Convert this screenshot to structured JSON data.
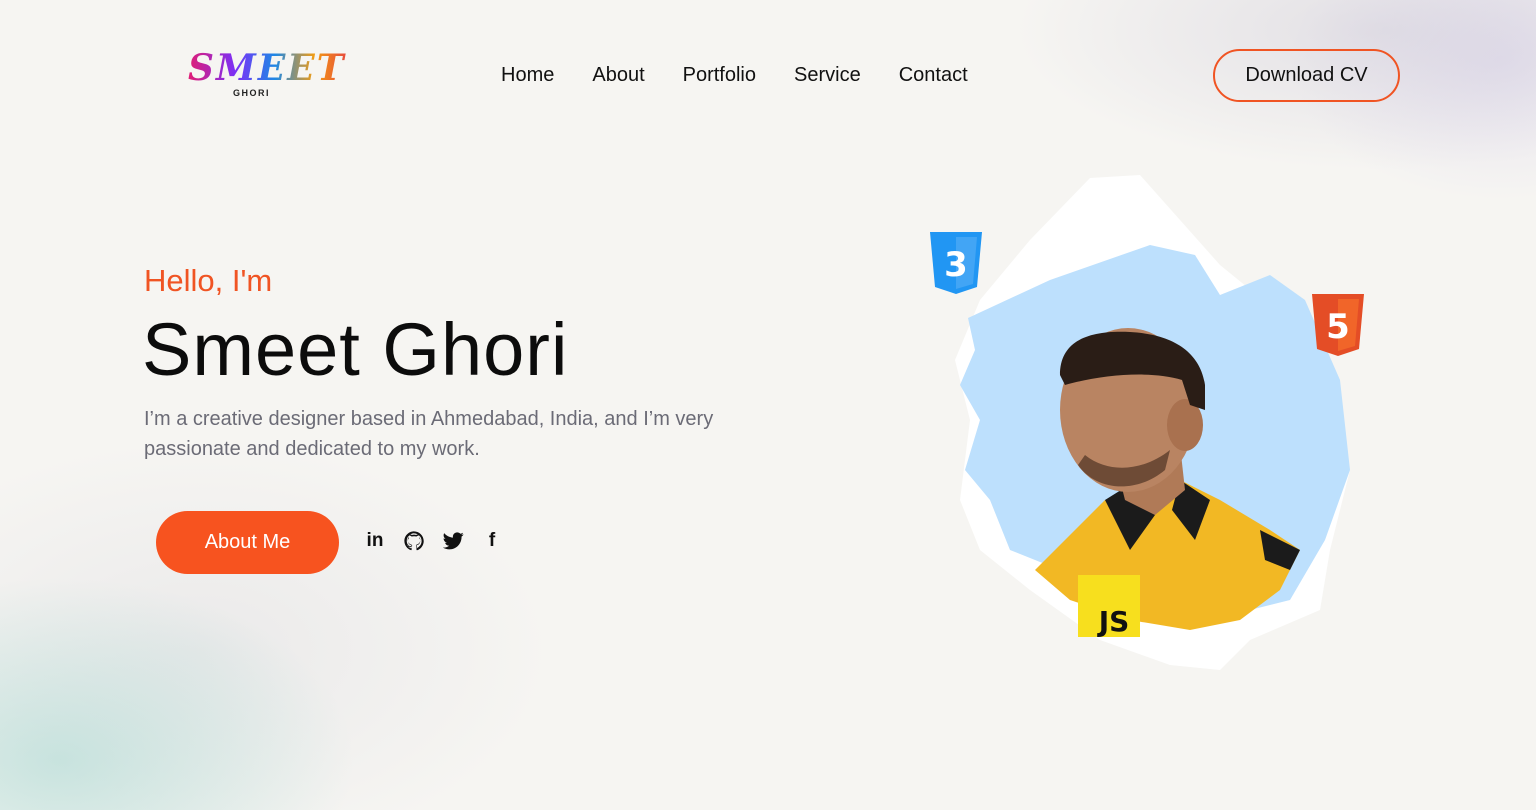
{
  "header": {
    "logo_main": "SMEET",
    "logo_sub": "GHORI",
    "nav": [
      "Home",
      "About",
      "Portfolio",
      "Service",
      "Contact"
    ],
    "cta_label": "Download CV"
  },
  "hero": {
    "greeting": "Hello, I'm",
    "name": "Smeet Ghori",
    "description": "I’m a creative designer based in Ahmedabad, India, and I’m very passionate and dedicated to my work.",
    "about_label": "About Me",
    "socials": [
      "linkedin-icon",
      "github-icon",
      "twitter-icon",
      "facebook-icon"
    ],
    "social_glyphs": {
      "linkedin": "in",
      "facebook": "f"
    }
  },
  "badges": {
    "css": {
      "label": "3",
      "color": "#2196f3"
    },
    "html": {
      "label": "5",
      "color": "#f1652a"
    },
    "js": {
      "label": "JS",
      "color": "#f7df1e"
    }
  },
  "colors": {
    "accent": "#f7531f",
    "text": "#111111",
    "muted": "#6b6b76"
  }
}
